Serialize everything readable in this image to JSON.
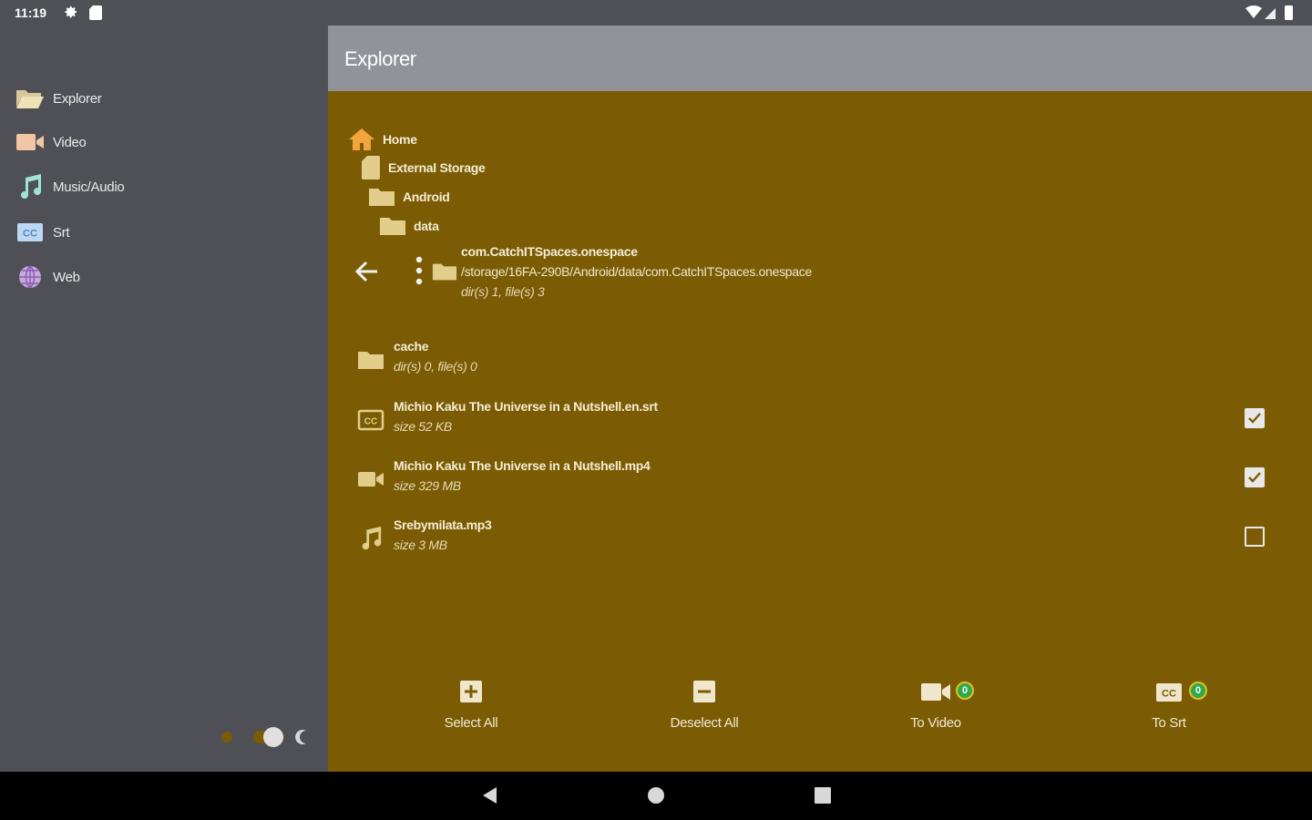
{
  "status": {
    "time": "11:19"
  },
  "sidebar": {
    "items": [
      {
        "label": "Explorer",
        "icon": "folder-open-icon"
      },
      {
        "label": "Video",
        "icon": "video-camera-icon"
      },
      {
        "label": "Music/Audio",
        "icon": "music-note-icon"
      },
      {
        "label": "Srt",
        "icon": "closed-caption-icon"
      },
      {
        "label": "Web",
        "icon": "globe-icon"
      }
    ]
  },
  "app_bar": {
    "title": "Explorer"
  },
  "breadcrumbs": [
    {
      "label": "Home",
      "icon": "home-icon"
    },
    {
      "label": "External Storage",
      "icon": "sd-card-icon"
    },
    {
      "label": "Android",
      "icon": "folder-icon"
    },
    {
      "label": "data",
      "icon": "folder-icon"
    }
  ],
  "current_dir": {
    "name": "com.CatchITSpaces.onespace",
    "path": "/storage/16FA-290B/Android/data/com.CatchITSpaces.onespace",
    "count": "dir(s) 1, file(s) 3"
  },
  "files": [
    {
      "name": "cache",
      "meta": "dir(s) 0, file(s) 0",
      "icon": "folder-icon",
      "checkbox": false
    },
    {
      "name": "Michio Kaku The Universe in a Nutshell.en.srt",
      "meta": "size 52 KB",
      "icon": "closed-caption-icon",
      "checkbox": true,
      "checked": true
    },
    {
      "name": "Michio Kaku The Universe in a Nutshell.mp4",
      "meta": "size 329 MB",
      "icon": "video-camera-icon",
      "checkbox": true,
      "checked": true
    },
    {
      "name": "Srebymilata.mp3",
      "meta": "size 3 MB",
      "icon": "music-note-icon",
      "checkbox": true,
      "checked": false
    }
  ],
  "actions": {
    "select_all": "Select All",
    "deselect_all": "Deselect All",
    "to_video": "To Video",
    "to_video_badge": "0",
    "to_srt": "To Srt",
    "to_srt_badge": "0"
  },
  "colors": {
    "sidebar_bg": "#4e5055",
    "main_bg": "#7b5c05",
    "app_bar_bg": "#909399",
    "badge_green": "#2fa84f"
  }
}
